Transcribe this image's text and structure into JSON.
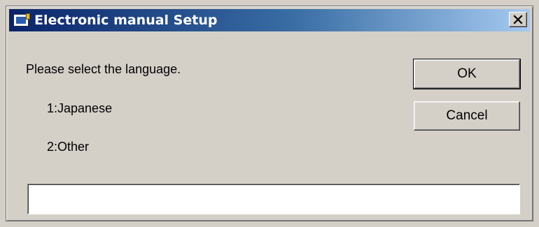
{
  "window": {
    "title": "Electronic manual  Setup",
    "icon": "setup-app-icon",
    "close_glyph": "✕"
  },
  "content": {
    "prompt": "Please select the language.",
    "options": [
      {
        "label": "1:Japanese"
      },
      {
        "label": "2:Other"
      }
    ]
  },
  "buttons": {
    "ok_label": "OK",
    "cancel_label": "Cancel"
  },
  "input": {
    "value": "",
    "placeholder": ""
  },
  "colors": {
    "titlebar_start": "#0a246a",
    "titlebar_end": "#a6caf0",
    "dialog_face": "#d4d0c8"
  }
}
